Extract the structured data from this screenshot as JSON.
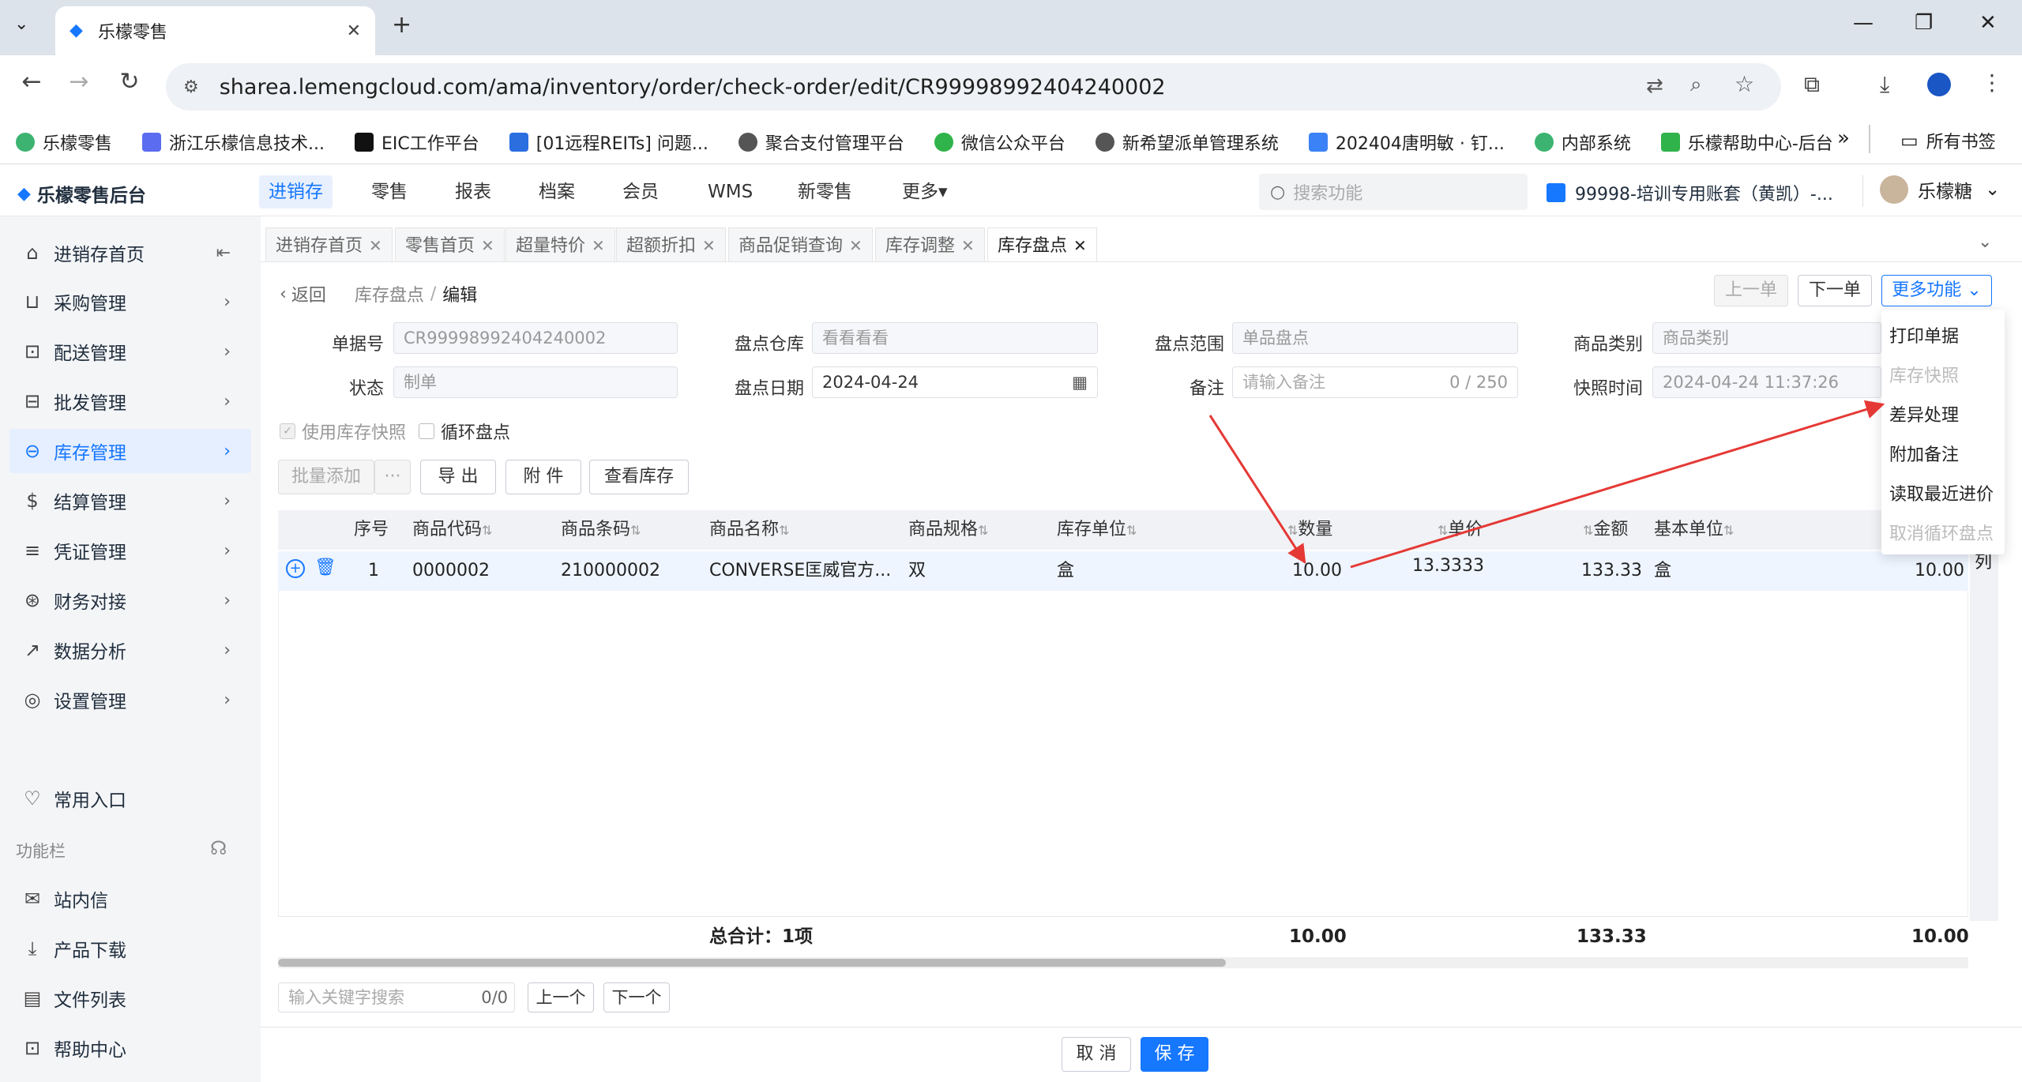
{
  "browser": {
    "tab_title": "乐檬零售",
    "url": "sharea.lemengcloud.com/ama/inventory/order/check-order/edit/CR99998992404240002",
    "bookmarks": [
      "乐檬零售",
      "浙江乐檬信息技术...",
      "EIC工作平台",
      "[01远程REITs] 问题...",
      "聚合支付管理平台",
      "微信公众平台",
      "新希望派单管理系统",
      "202404唐明敏 · 钉...",
      "内部系统",
      "乐檬帮助中心-后台"
    ],
    "all_bookmarks": "所有书签",
    "more": "»"
  },
  "header": {
    "logo": "乐檬零售后台",
    "nav": [
      "进销存",
      "零售",
      "报表",
      "档案",
      "会员",
      "WMS",
      "新零售",
      "更多▾"
    ],
    "search_placeholder": "搜索功能",
    "account": "99998-培训专用账套（黄凯）-...",
    "user": "乐檬糖"
  },
  "sidebar": {
    "items": [
      "进销存首页",
      "采购管理",
      "配送管理",
      "批发管理",
      "库存管理",
      "结算管理",
      "凭证管理",
      "财务对接",
      "数据分析",
      "设置管理"
    ],
    "common": "常用入口",
    "funcbar": "功能栏",
    "func_items": [
      "站内信",
      "产品下载",
      "文件列表",
      "帮助中心"
    ]
  },
  "page_tabs": [
    "进销存首页",
    "零售首页",
    "超量特价",
    "超额折扣",
    "商品促销查询",
    "库存调整",
    "库存盘点"
  ],
  "breadcrumb": {
    "back": "返回",
    "parent": "库存盘点",
    "sep": "/",
    "current": "编辑"
  },
  "top_buttons": {
    "prev": "上一单",
    "next": "下一单",
    "more": "更多功能"
  },
  "form": {
    "doc_no_label": "单据号",
    "doc_no": "CR99998992404240002",
    "warehouse_label": "盘点仓库",
    "warehouse": "看看看看",
    "scope_label": "盘点范围",
    "scope": "单品盘点",
    "category_label": "商品类别",
    "category_placeholder": "商品类别",
    "status_label": "状态",
    "status": "制单",
    "date_label": "盘点日期",
    "date": "2024-04-24",
    "remark_label": "备注",
    "remark_placeholder": "请输入备注",
    "remark_count": "0 / 250",
    "snapshot_label": "快照时间",
    "snapshot": "2024-04-24 11:37:26",
    "use_snapshot": "使用库存快照",
    "cycle": "循环盘点"
  },
  "toolbar": {
    "batch_add": "批量添加",
    "dots": "···",
    "export": "导 出",
    "attach": "附 件",
    "view_stock": "查看库存"
  },
  "table": {
    "headers": [
      "序号",
      "商品代码",
      "商品条码",
      "商品名称",
      "商品规格",
      "库存单位",
      "数量",
      "单价",
      "金额",
      "基本单位"
    ],
    "rows": [
      {
        "seq": "1",
        "code": "0000002",
        "barcode": "210000002",
        "name": "CONVERSE匡威官方...",
        "spec": "双",
        "unit": "盒",
        "qty": "10.00",
        "price": "13.3333",
        "amount": "133.33",
        "base_unit": "盒",
        "last": "10.00"
      }
    ],
    "total_label": "总合计：1项",
    "total_qty": "10.00",
    "total_amount": "133.33",
    "total_last": "10.00",
    "col_label": "列"
  },
  "find": {
    "placeholder": "输入关键字搜索",
    "count": "0/0",
    "prev": "上一个",
    "next": "下一个"
  },
  "dropdown": [
    "打印单据",
    "库存快照",
    "差异处理",
    "附加备注",
    "读取最近进价",
    "取消循环盘点"
  ],
  "footer": {
    "cancel": "取 消",
    "save": "保 存"
  },
  "colors": {
    "accent": "#1677ff",
    "arrow": "#e53935"
  }
}
